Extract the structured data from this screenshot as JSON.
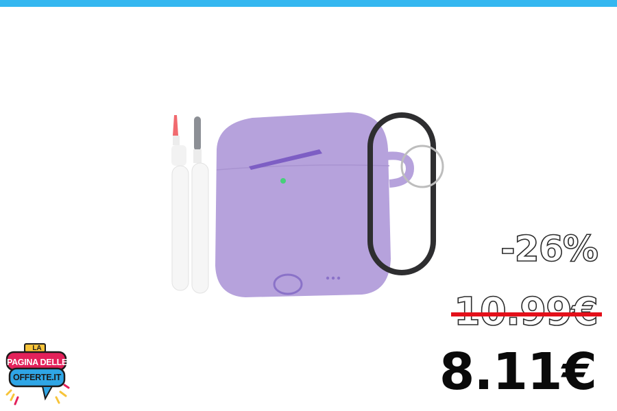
{
  "banner": {
    "accent_color": "#35b7f0"
  },
  "product": {
    "image_icon": "airpods-case-with-carabiner-and-cleaning-pens",
    "case_color": "#b6a2dc"
  },
  "offer": {
    "discount": "-26%",
    "old_price": "10.99€",
    "new_price": "8.11€",
    "strike_color": "#e3101a"
  },
  "logo": {
    "line_top": "LA",
    "line_1": "PAGINA DELLE",
    "line_2": "OFFERTE.IT"
  }
}
